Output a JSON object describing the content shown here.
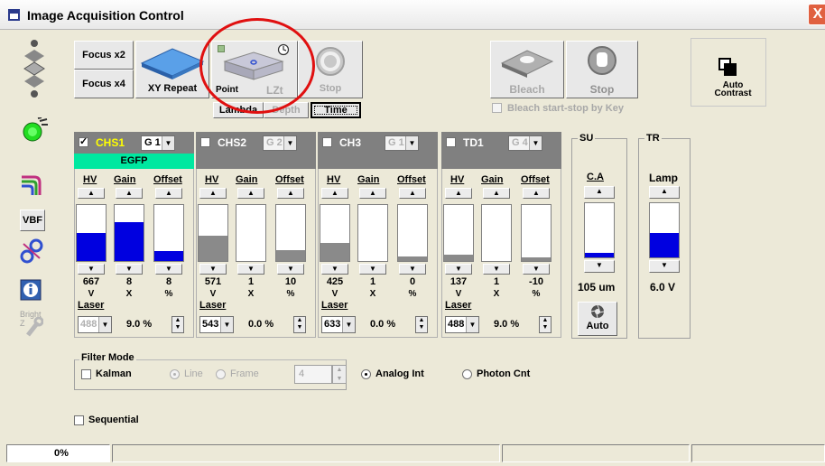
{
  "window": {
    "title": "Image Acquisition Control",
    "close_glyph": "X"
  },
  "scan": {
    "focus_x2": "Focus x2",
    "focus_x4": "Focus x4",
    "xy_repeat": "XY Repeat",
    "point_label": "Point",
    "lzt_label": "LZt",
    "stop_label": "Stop",
    "tabs": [
      "Lambda",
      "Depth",
      "Time"
    ]
  },
  "bleach": {
    "bleach_label": "Bleach",
    "stop_label": "Stop",
    "key_label": "Bleach start-stop by Key"
  },
  "auto_contrast": "Auto Contrast",
  "left_tools": {
    "vbf": "VBF",
    "bright_z": "Bright Z"
  },
  "col_labels": {
    "hv": "HV",
    "gain": "Gain",
    "offset": "Offset",
    "laser": "Laser"
  },
  "channels": [
    {
      "name": "CHS1",
      "checked": true,
      "group": "G 1",
      "dye": "EGFP",
      "hv": "667",
      "gain": "8",
      "offset": "8",
      "hv_unit": "V",
      "gain_unit": "X",
      "offset_unit": "%",
      "hv_level": 0.5,
      "gain_level": 0.7,
      "offset_level": 0.17,
      "laser": "488",
      "laser_pct": "9.0 %",
      "color": "#0000e0"
    },
    {
      "name": "CHS2",
      "checked": false,
      "group": "G 2",
      "dye": "",
      "hv": "571",
      "gain": "1",
      "offset": "10",
      "hv_unit": "V",
      "gain_unit": "X",
      "offset_unit": "%",
      "hv_level": 0.45,
      "gain_level": 0.0,
      "offset_level": 0.2,
      "laser": "543",
      "laser_pct": "0.0 %",
      "color": "#8a8a8a"
    },
    {
      "name": "CH3",
      "checked": false,
      "group": "G 1",
      "dye": "",
      "hv": "425",
      "gain": "1",
      "offset": "0",
      "hv_unit": "V",
      "gain_unit": "X",
      "offset_unit": "%",
      "hv_level": 0.33,
      "gain_level": 0.0,
      "offset_level": 0.08,
      "laser": "633",
      "laser_pct": "0.0 %",
      "color": "#8a8a8a"
    },
    {
      "name": "TD1",
      "checked": false,
      "group": "G 4",
      "dye": "",
      "hv": "137",
      "gain": "1",
      "offset": "-10",
      "hv_unit": "V",
      "gain_unit": "X",
      "offset_unit": "%",
      "hv_level": 0.12,
      "gain_level": 0.0,
      "offset_level": 0.06,
      "laser": "488",
      "laser_pct": "9.0 %",
      "color": "#8a8a8a"
    }
  ],
  "su": {
    "title": "SU",
    "label": "C.A",
    "value": "105 um",
    "level": 0.08,
    "auto": "Auto"
  },
  "tr": {
    "title": "TR",
    "label": "Lamp",
    "value": "6.0 V",
    "level": 0.45
  },
  "filter": {
    "title": "Filter Mode",
    "kalman": "Kalman",
    "line": "Line",
    "frame": "Frame",
    "frame_count": "4",
    "analog": "Analog Int",
    "photon": "Photon Cnt"
  },
  "sequential": "Sequential",
  "status": {
    "progress": "0%"
  }
}
